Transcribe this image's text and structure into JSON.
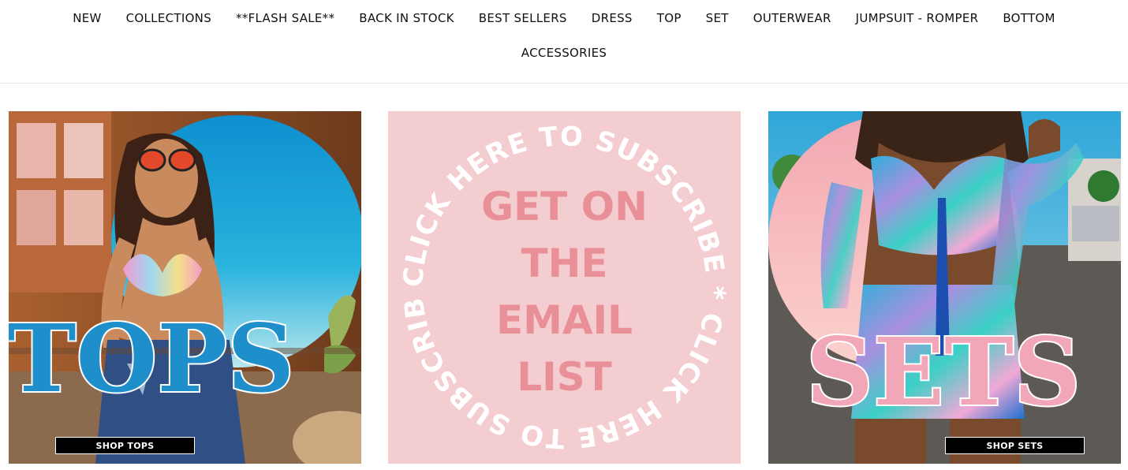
{
  "nav": {
    "row1": [
      "NEW",
      "COLLECTIONS",
      "**FLASH SALE**",
      "BACK IN STOCK",
      "BEST SELLERS",
      "DRESS",
      "TOP",
      "SET",
      "OUTERWEAR",
      "JUMPSUIT - ROMPER",
      "BOTTOM"
    ],
    "row2": [
      "ACCESSORIES"
    ]
  },
  "tiles": {
    "tops": {
      "word": "TOPS",
      "button": "SHOP TOPS"
    },
    "subscribe": {
      "ring_text": "CLICK HERE TO SUBSCRIBE * CLICK HERE TO SUBSCRIBE *",
      "lines": [
        "GET ON",
        "THE",
        "EMAIL",
        "LIST"
      ]
    },
    "sets": {
      "word": "SETS",
      "button": "SHOP SETS"
    }
  },
  "colors": {
    "tops_letter": "#1f8fcc",
    "sets_letter": "#f2a7b8",
    "subscribe_bg": "#f4cdd1",
    "subscribe_text": "#e98f98"
  }
}
